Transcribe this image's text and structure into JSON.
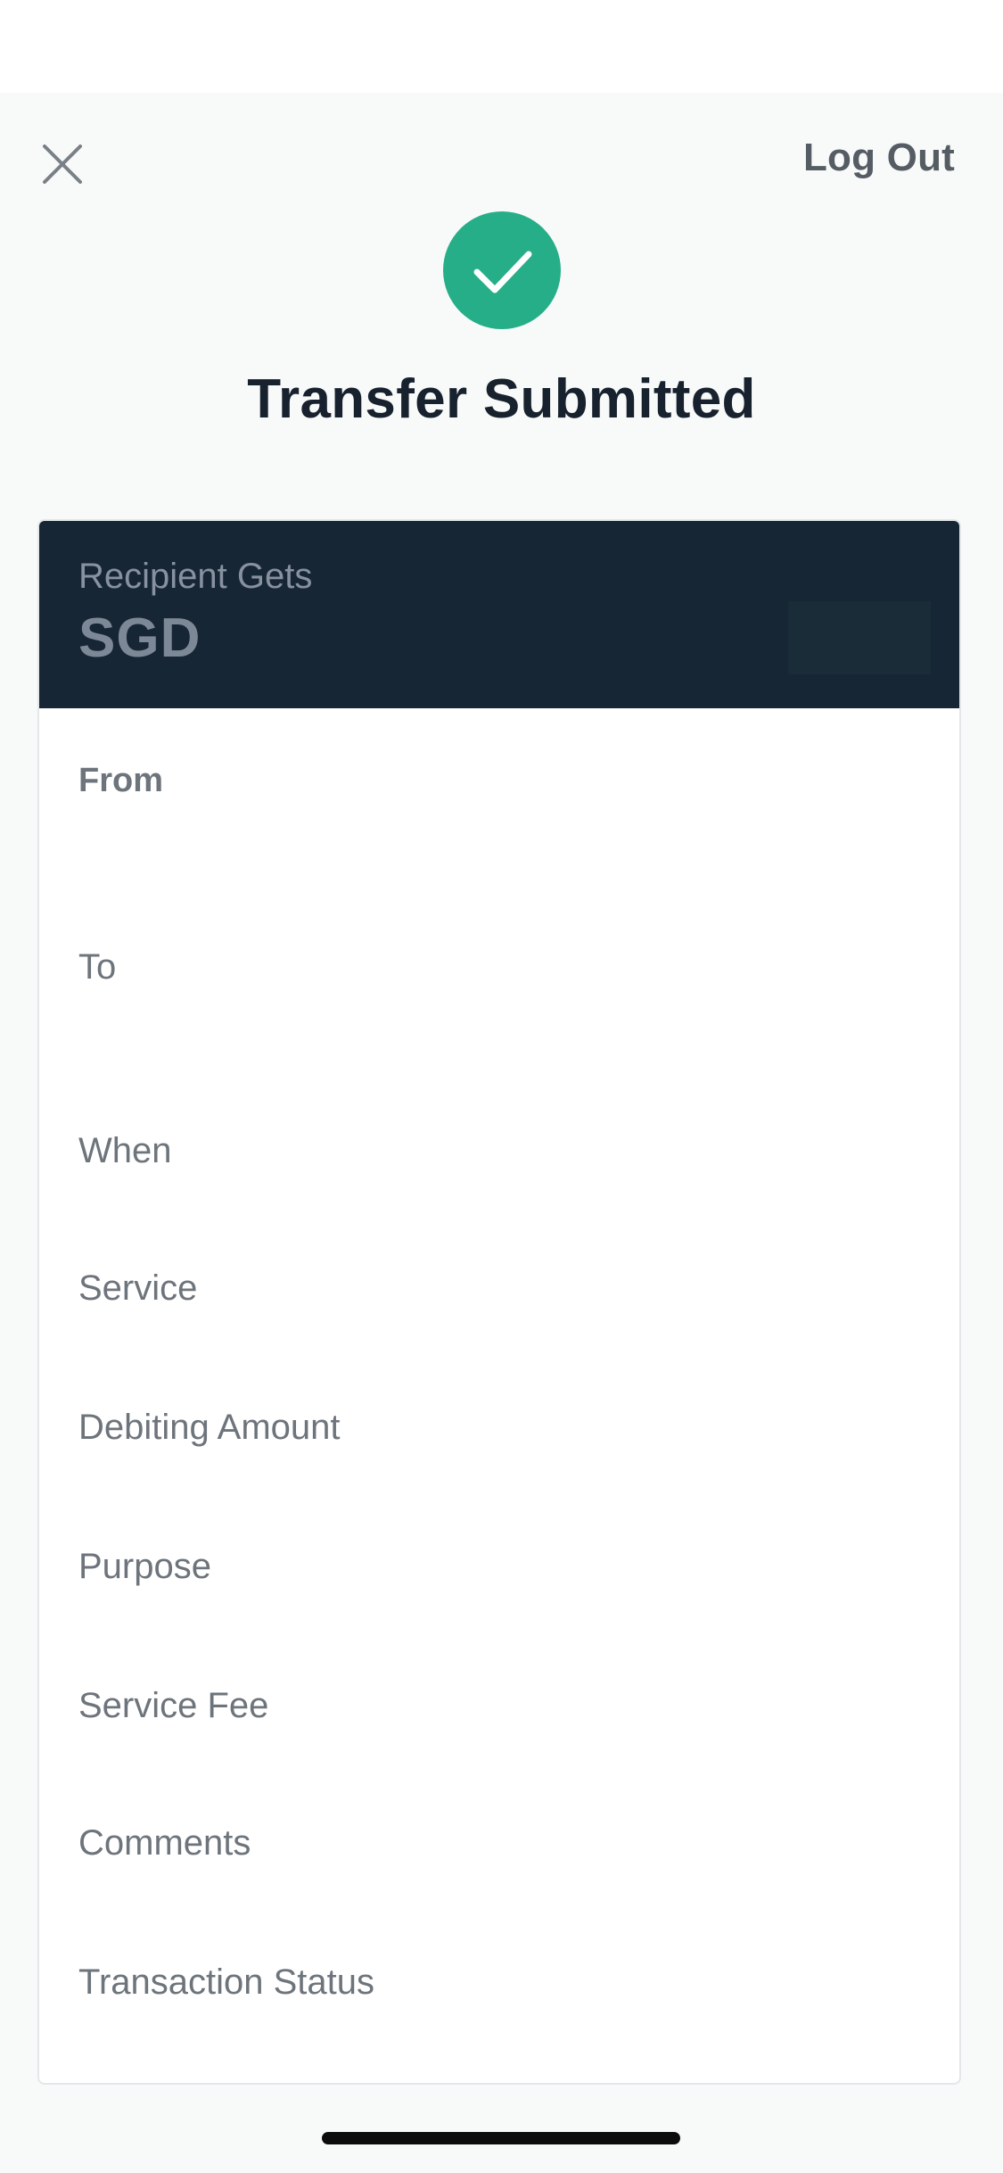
{
  "header": {
    "logout_label": "Log Out",
    "close_icon": "close-icon"
  },
  "status": {
    "icon": "checkmark-icon",
    "title": "Transfer Submitted",
    "accent_color": "#26ae89"
  },
  "summary": {
    "recipient_label": "Recipient Gets",
    "currency": "SGD",
    "header_color": "#172634"
  },
  "details": {
    "from": "From",
    "to": "To",
    "when": "When",
    "service": "Service",
    "debiting_amount": "Debiting Amount",
    "purpose": "Purpose",
    "service_fee": "Service Fee",
    "comments": "Comments",
    "transaction_status": "Transaction Status"
  }
}
